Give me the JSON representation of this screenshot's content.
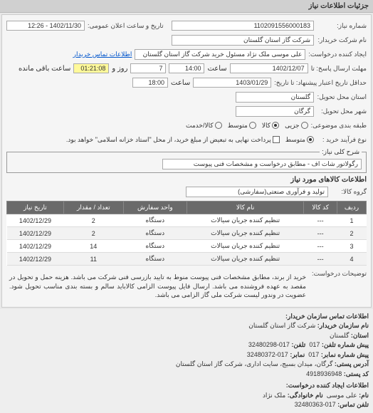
{
  "header": {
    "title": "جزئیات اطلاعات نیاز"
  },
  "form": {
    "req_no_label": "شماره نیاز:",
    "req_no": "1102091556000183",
    "pub_label": "تاریخ و ساعت اعلان عمومی:",
    "pub_value": "1402/11/30 - 12:26",
    "buyer_label": "نام شرکت خریدار:",
    "buyer": "شرکت گاز استان گلستان",
    "creator_label": "ایجاد کننده درخواست:",
    "creator": "علی موسی ملک نژاد مسئول خرید شرکت گاز استان گلستان",
    "contact_link": "اطلاعات تماس خریدار",
    "deadline_send_label": "مهلت ارسال پاسخ: تا",
    "deadline_date": "1402/12/07",
    "deadline_time_label": "ساعت",
    "deadline_time": "14:00",
    "remain_days": "7",
    "remain_days_label": "روز و",
    "remain_time": "01:21:08",
    "remain_suffix": "ساعت باقی مانده",
    "validity_label": "حداقل تاریخ اعتبار پیشنهاد: تا تاریخ:",
    "validity_date": "1403/01/29",
    "validity_time_label": "ساعت",
    "validity_time": "18:00",
    "province_label": "استان محل تحویل:",
    "province": "گلستان",
    "city_label": "شهر محل تحویل:",
    "city": "گرگان",
    "budget_label": "طبقه بندی موضوعی:",
    "budget_opts": [
      "جزیی",
      "کالا",
      "متوسط",
      "کالا/خدمت"
    ],
    "budget_selected": 1,
    "process_label": "نوع فرآیند خرید :",
    "process_opts": [
      "متوسط",
      "پرداخت نهایی به تبعیض از مبلغ خرید، از محل \"استاد خزانه اسلامی\" خواهد بود."
    ],
    "process_selected": 0
  },
  "titleField": {
    "label": "شرح کلی نیاز:",
    "value": "رگولاتور شات اف - مطابق درخواست و مشخصات فنی پیوست"
  },
  "goods": {
    "header": "اطلاعات کالاهای مورد نیاز",
    "group_label": "گروه کالا:",
    "group_value": "تولید و فرآوری صنعتی(سفارشی)",
    "columns": [
      "ردیف",
      "کد کالا",
      "نام کالا",
      "واحد سفارش",
      "تعداد / مقدار",
      "تاریخ نیاز"
    ],
    "rows": [
      {
        "n": "1",
        "code": "---",
        "name": "تنظیم کننده جریان سیالات",
        "unit": "دستگاه",
        "qty": "2",
        "date": "1402/12/29"
      },
      {
        "n": "2",
        "code": "---",
        "name": "تنظیم کننده جریان سیالات",
        "unit": "دستگاه",
        "qty": "2",
        "date": "1402/12/29"
      },
      {
        "n": "3",
        "code": "---",
        "name": "تنظیم کننده جریان سیالات",
        "unit": "دستگاه",
        "qty": "14",
        "date": "1402/12/29"
      },
      {
        "n": "4",
        "code": "---",
        "name": "تنظیم کننده جریان سیالات",
        "unit": "دستگاه",
        "qty": "11",
        "date": "1402/12/29"
      }
    ]
  },
  "notes": {
    "label": "توضیحات درخواست:",
    "text": "خرید از برند، مطابق مشخصات فنی پیوست منوط به تایید بازرسی فنی شرکت می باشد. هزینه حمل و تحویل در مقصد به عهده فروشنده می باشد. ارسال فایل پیوست الزامی کالاباید سالم و بسته بندی مناسب تحویل شود. عضویت در وندور لیست شرکت ملی گاز الزامی می باشد."
  },
  "contact": {
    "header": "اطلاعات تماس سازمان خریدار:",
    "org_label": "نام سازمان خریدار:",
    "org": "شرکت گاز استان گلستان",
    "province_label": "استان:",
    "province": "گلستان",
    "phone_pre_label": "پیش شماره تلفن:",
    "phone_pre": "017",
    "phone_label": "تلفن:",
    "phone": "017-32480298",
    "fax_pre_label": "پیش شماره نمابر:",
    "fax_pre": "017",
    "fax_label": "نمابر:",
    "fax": "017-32480372",
    "addr_label": "آدرس پستی:",
    "addr": "گرگان، میدان بسیج، سایت اداری، شرکت گاز استان گلستان",
    "zip_label": "کد پستی:",
    "zip": "4918936948",
    "creator_header": "اطلاعات ایجاد کننده درخواست:",
    "name_label": "نام:",
    "name": "علی موسی",
    "lname_label": "نام خانوادگی:",
    "lname": "ملک نژاد",
    "cphone_label": "تلفن تماس:",
    "cphone": "017-32480363"
  }
}
